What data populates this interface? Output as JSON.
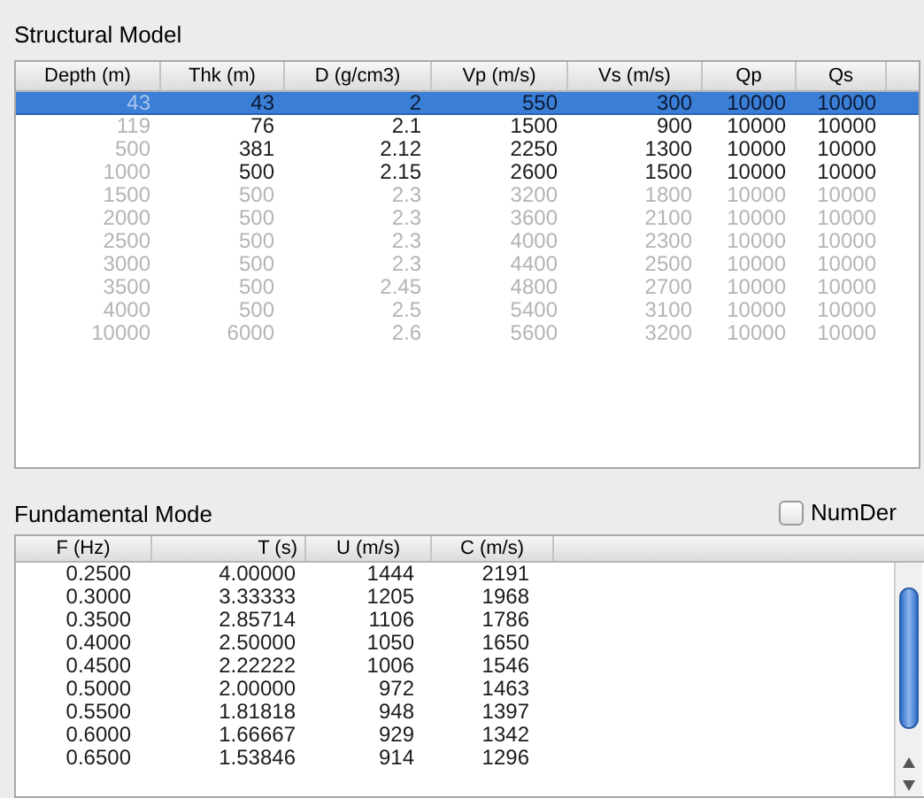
{
  "structural_model": {
    "title": "Structural Model",
    "columns": [
      {
        "label": "Depth (m)",
        "disabled": true
      },
      {
        "label": "Thk (m)",
        "disabled": false
      },
      {
        "label": "D (g/cm3)",
        "disabled": false
      },
      {
        "label": "Vp (m/s)",
        "disabled": false
      },
      {
        "label": "Vs (m/s)",
        "disabled": false
      },
      {
        "label": "Qp",
        "disabled": false
      },
      {
        "label": "Qs",
        "disabled": false
      }
    ],
    "rows": [
      {
        "cells": [
          "43",
          "43",
          "2",
          "550",
          "300",
          "10000",
          "10000"
        ],
        "selected": true,
        "disabled": false
      },
      {
        "cells": [
          "119",
          "76",
          "2.1",
          "1500",
          "900",
          "10000",
          "10000"
        ],
        "selected": false,
        "disabled": false
      },
      {
        "cells": [
          "500",
          "381",
          "2.12",
          "2250",
          "1300",
          "10000",
          "10000"
        ],
        "selected": false,
        "disabled": false
      },
      {
        "cells": [
          "1000",
          "500",
          "2.15",
          "2600",
          "1500",
          "10000",
          "10000"
        ],
        "selected": false,
        "disabled": false
      },
      {
        "cells": [
          "1500",
          "500",
          "2.3",
          "3200",
          "1800",
          "10000",
          "10000"
        ],
        "selected": false,
        "disabled": true
      },
      {
        "cells": [
          "2000",
          "500",
          "2.3",
          "3600",
          "2100",
          "10000",
          "10000"
        ],
        "selected": false,
        "disabled": true
      },
      {
        "cells": [
          "2500",
          "500",
          "2.3",
          "4000",
          "2300",
          "10000",
          "10000"
        ],
        "selected": false,
        "disabled": true
      },
      {
        "cells": [
          "3000",
          "500",
          "2.3",
          "4400",
          "2500",
          "10000",
          "10000"
        ],
        "selected": false,
        "disabled": true
      },
      {
        "cells": [
          "3500",
          "500",
          "2.45",
          "4800",
          "2700",
          "10000",
          "10000"
        ],
        "selected": false,
        "disabled": true
      },
      {
        "cells": [
          "4000",
          "500",
          "2.5",
          "5400",
          "3100",
          "10000",
          "10000"
        ],
        "selected": false,
        "disabled": true
      },
      {
        "cells": [
          "10000",
          "6000",
          "2.6",
          "5600",
          "3200",
          "10000",
          "10000"
        ],
        "selected": false,
        "disabled": true
      }
    ]
  },
  "fundamental_mode": {
    "title": "Fundamental Mode",
    "numder": {
      "label": "NumDer",
      "checked": false
    },
    "columns": [
      "F (Hz)",
      "T (s)",
      "U (m/s)",
      "C (m/s)"
    ],
    "rows": [
      [
        "0.2500",
        "4.00000",
        "1444",
        "2191"
      ],
      [
        "0.3000",
        "3.33333",
        "1205",
        "1968"
      ],
      [
        "0.3500",
        "2.85714",
        "1106",
        "1786"
      ],
      [
        "0.4000",
        "2.50000",
        "1050",
        "1650"
      ],
      [
        "0.4500",
        "2.22222",
        "1006",
        "1546"
      ],
      [
        "0.5000",
        "2.00000",
        "972",
        "1463"
      ],
      [
        "0.5500",
        "1.81818",
        "948",
        "1397"
      ],
      [
        "0.6000",
        "1.66667",
        "929",
        "1342"
      ],
      [
        "0.6500",
        "1.53846",
        "914",
        "1296"
      ]
    ]
  }
}
